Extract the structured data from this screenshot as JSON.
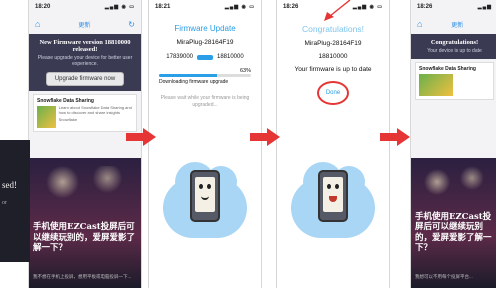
{
  "phone1": {
    "time": "18:20",
    "nav_title": "更新",
    "banner_title": "New Firmware version 18810000 released!",
    "banner_sub": "Please upgrade your device for better user experience.",
    "upgrade_button": "Upgrade firmware now",
    "ad_title": "Snowflake Data Sharing",
    "ad_text": "Learn about Snowflake Data Sharing and how to discover and share insights",
    "ad_brand": "Snowflake",
    "cn_title": "手机使用EZCast投屏后可以继续玩别的，爱屏爱影了解一下？",
    "cn_sub": "我不想在手机上投屏，想用平板或电脑投屏一下..."
  },
  "phone2": {
    "time": "18:21",
    "title": "Firmware Update",
    "device": "MiraPlug-28164F19",
    "from_version": "17839000",
    "to_version": "18810000",
    "percent": "63%",
    "progress": 0.63,
    "status": "Downloading firmware upgrade",
    "note": "Please wait while your firmware is being upgraded..."
  },
  "phone3": {
    "time": "18:26",
    "title": "Congratulations!",
    "device": "MiraPlug-28164F19",
    "version": "18810000",
    "status": "Your firmware is up to date",
    "done_button": "Done"
  },
  "phone4": {
    "time": "18:26",
    "nav_title": "更新",
    "banner_title": "Congratulations!",
    "banner_sub": "Your device is up to date",
    "ad_title": "Snowflake Data Sharing",
    "cn_title": "手机使用EZCast投屏后可以继续玩别的，爱屏爱影了解一下？",
    "cn_sub": "我想可以不用每个投屏平台..."
  },
  "overlay": {
    "text": "sed!",
    "sub": "or"
  },
  "colors": {
    "accent": "#2a9ee6",
    "arrow": "#e53535",
    "banner": "#3a3a52"
  }
}
